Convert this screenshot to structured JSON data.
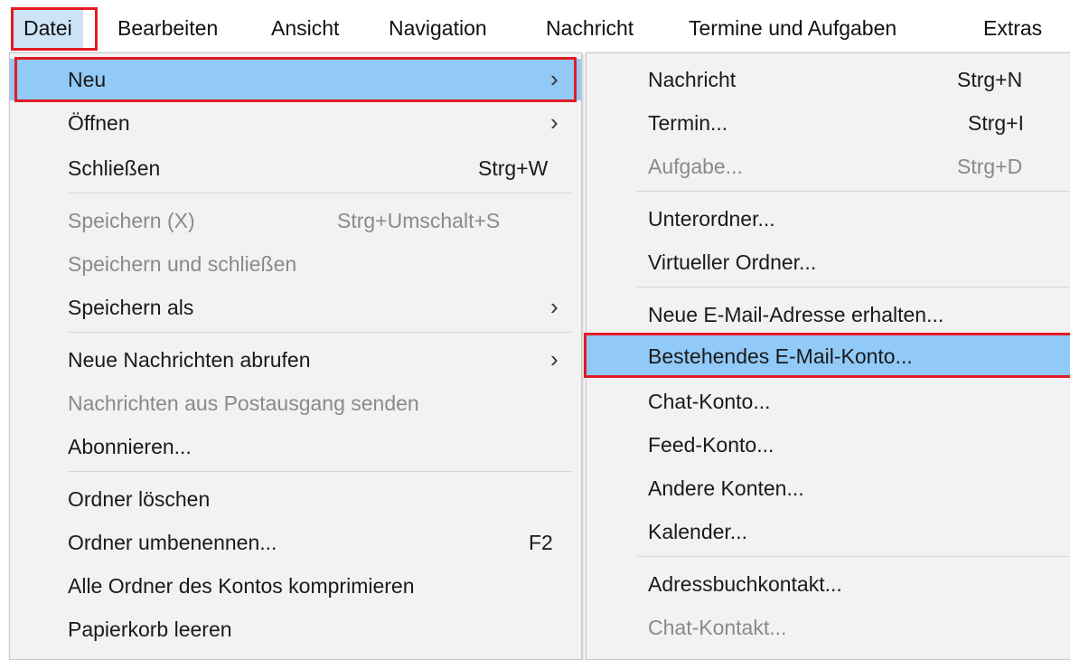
{
  "menubar": {
    "items": [
      "Datei",
      "Bearbeiten",
      "Ansicht",
      "Navigation",
      "Nachricht",
      "Termine und Aufgaben",
      "Extras"
    ]
  },
  "file_menu": {
    "items": [
      {
        "label": "Neu",
        "shortcut": "",
        "arrow": "›"
      },
      {
        "label": "Öffnen",
        "shortcut": "",
        "arrow": "›"
      },
      {
        "label": "Schließen",
        "shortcut": "Strg+W",
        "arrow": ""
      },
      {
        "label": "Speichern (X)",
        "shortcut": "Strg+Umschalt+S",
        "arrow": ""
      },
      {
        "label": "Speichern und schließen",
        "shortcut": "",
        "arrow": ""
      },
      {
        "label": "Speichern als",
        "shortcut": "",
        "arrow": "›"
      },
      {
        "label": "Neue Nachrichten abrufen",
        "shortcut": "",
        "arrow": "›"
      },
      {
        "label": "Nachrichten aus Postausgang senden",
        "shortcut": "",
        "arrow": ""
      },
      {
        "label": "Abonnieren...",
        "shortcut": "",
        "arrow": ""
      },
      {
        "label": "Ordner löschen",
        "shortcut": "",
        "arrow": ""
      },
      {
        "label": "Ordner umbenennen...",
        "shortcut": "F2",
        "arrow": ""
      },
      {
        "label": "Alle Ordner des Kontos komprimieren",
        "shortcut": "",
        "arrow": ""
      },
      {
        "label": "Papierkorb leeren",
        "shortcut": "",
        "arrow": ""
      }
    ]
  },
  "new_submenu": {
    "items": [
      {
        "label": "Nachricht",
        "shortcut": "Strg+N"
      },
      {
        "label": "Termin...",
        "shortcut": "Strg+I"
      },
      {
        "label": "Aufgabe...",
        "shortcut": "Strg+D"
      },
      {
        "label": "Unterordner...",
        "shortcut": ""
      },
      {
        "label": "Virtueller Ordner...",
        "shortcut": ""
      },
      {
        "label": "Neue E-Mail-Adresse erhalten...",
        "shortcut": ""
      },
      {
        "label": "Bestehendes E-Mail-Konto...",
        "shortcut": ""
      },
      {
        "label": "Chat-Konto...",
        "shortcut": ""
      },
      {
        "label": "Feed-Konto...",
        "shortcut": ""
      },
      {
        "label": "Andere Konten...",
        "shortcut": ""
      },
      {
        "label": "Kalender...",
        "shortcut": ""
      },
      {
        "label": "Adressbuchkontakt...",
        "shortcut": ""
      },
      {
        "label": "Chat-Kontakt...",
        "shortcut": ""
      }
    ]
  },
  "colors": {
    "highlight": "#91c9f7",
    "annotation_red": "#e21b23",
    "menu_bg": "#f2f2f2",
    "disabled_text": "#8a8a8a"
  }
}
